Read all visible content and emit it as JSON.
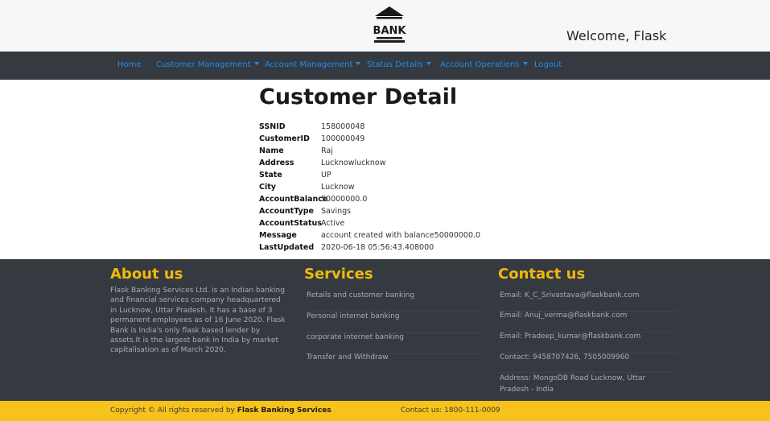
{
  "header": {
    "logo_text": "BANK",
    "welcome": "Welcome, Flask"
  },
  "nav": {
    "items": [
      {
        "label": "Home",
        "dropdown": false
      },
      {
        "label": "Customer Management",
        "dropdown": true
      },
      {
        "label": "Account Management",
        "dropdown": true
      },
      {
        "label": "Status Details",
        "dropdown": true
      },
      {
        "label": "Account Operations",
        "dropdown": true
      },
      {
        "label": "Logout",
        "dropdown": false
      }
    ]
  },
  "main": {
    "title": "Customer Detail",
    "details": [
      {
        "label": "SSNID",
        "value": "158000048"
      },
      {
        "label": "CustomerID",
        "value": "100000049"
      },
      {
        "label": "Name",
        "value": "Raj"
      },
      {
        "label": "Address",
        "value": "Lucknowlucknow"
      },
      {
        "label": "State",
        "value": "UP"
      },
      {
        "label": "City",
        "value": "Lucknow"
      },
      {
        "label": "AccountBalance",
        "value": "50000000.0"
      },
      {
        "label": "AccountType",
        "value": "Savings"
      },
      {
        "label": "AccountStatus",
        "value": "Active"
      },
      {
        "label": "Message",
        "value": "account created with balance50000000.0"
      },
      {
        "label": "LastUpdated",
        "value": "2020-06-18 05:56:43.408000"
      }
    ]
  },
  "footer": {
    "about": {
      "heading": "About us",
      "text": "Flask Banking Services Ltd. is an Indian banking and financial services company headquartered in Lucknow, Uttar Pradesh. It has a base of 3 permanent employees as of 16 June 2020. Flask Bank is India's only flask based lender by assets.It is the largest bank in India by market capitalisation as of March 2020."
    },
    "services": {
      "heading": "Services",
      "items": [
        "Retails and customer banking",
        "Personal internet banking",
        "corporate internet banking",
        "Transfer and Withdraw"
      ]
    },
    "contact": {
      "heading": "Contact us",
      "items": [
        "Email: K_C_Srivastava@flaskbank.com",
        "Email: Anuj_verma@flaskbank.com",
        "Email: Pradeep_kumar@flaskbank.com",
        "Contact: 9458707426, 7505009960",
        "Address: MongoDB Road Lucknow, Uttar Pradesh - India"
      ]
    }
  },
  "bottom_bar": {
    "copyright_prefix": "Copyright © All rights reserved by",
    "copyright_brand": "Flask Banking Services",
    "contact": "Contact us: 1800-111-0009"
  },
  "colors": {
    "nav_bg": "#343a40",
    "nav_link": "#1f8ded",
    "footer_heading": "#f0b90b",
    "copyright_bar": "#f7c21b"
  }
}
